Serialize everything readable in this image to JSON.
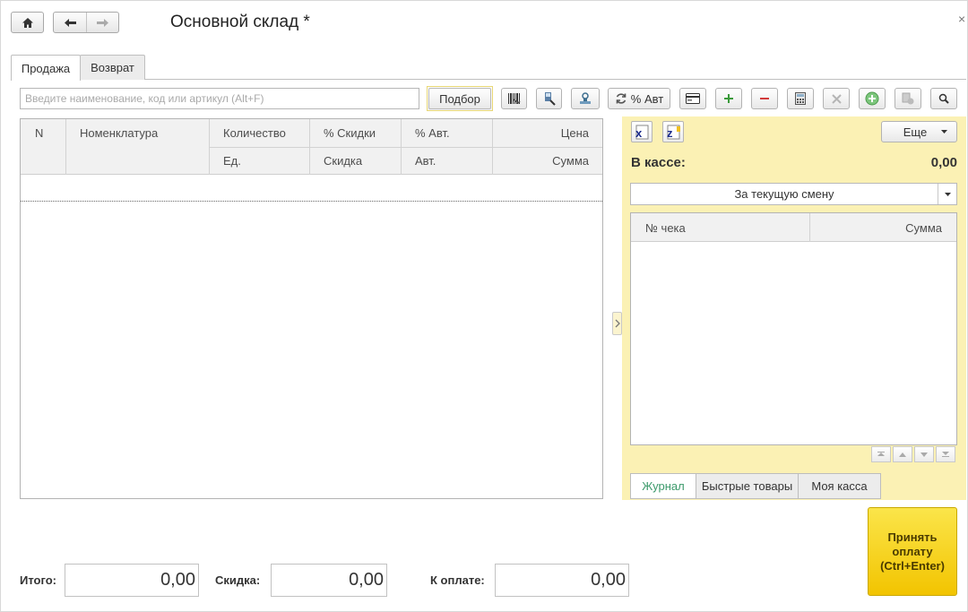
{
  "window": {
    "title": "Основной склад *",
    "close_glyph": "×"
  },
  "tabs": {
    "sale": "Продажа",
    "return": "Возврат"
  },
  "search": {
    "placeholder": "Введите наименование, код или артикул (Alt+F)",
    "value": ""
  },
  "toolbar": {
    "podbor_label": "Подбор",
    "auto_discount_label": "% Авт",
    "icons": [
      "barcode-icon",
      "scanner-icon",
      "stamp-icon",
      "refresh-discount-icon",
      "card-icon",
      "plus-icon",
      "minus-icon",
      "calculator-icon",
      "delete-icon",
      "add-circle-icon",
      "copy-icon",
      "search-icon"
    ]
  },
  "goods_table": {
    "headers": {
      "n": "N",
      "nomenclature": "Номенклатура",
      "quantity": "Количество",
      "discount_pct": "% Скидки",
      "auto_pct": "% Авт.",
      "price": "Цена",
      "unit": "Ед.",
      "discount": "Скидка",
      "auto": "Авт.",
      "sum": "Сумма"
    },
    "rows": []
  },
  "right_panel": {
    "more_label": "Еще",
    "in_cash_label": "В кассе:",
    "in_cash_value": "0,00",
    "shift_select": "За текущую смену",
    "receipt_headers": {
      "number": "№ чека",
      "sum": "Сумма"
    },
    "bottom_tabs": [
      "Журнал",
      "Быстрые товары",
      "Моя касса"
    ],
    "active_bottom_tab": "Журнал"
  },
  "pay_button": {
    "line1": "Принять",
    "line2": "оплату",
    "line3": "(Ctrl+Enter)"
  },
  "totals": {
    "total_label": "Итого:",
    "total_value": "0,00",
    "discount_label": "Скидка:",
    "discount_value": "0,00",
    "to_pay_label": "К оплате:",
    "to_pay_value": "0,00"
  },
  "colors": {
    "panel_yellow": "#fbf1b4",
    "pay_yellow": "#f6d31a",
    "active_tab_green": "#3c9a6b"
  }
}
